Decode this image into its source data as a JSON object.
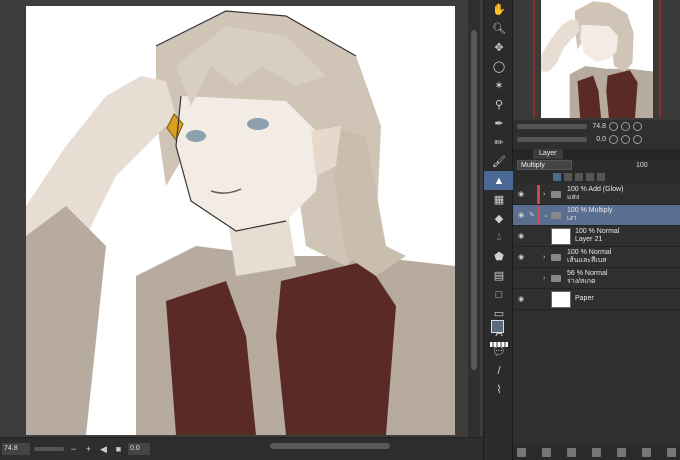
{
  "status_bar": {
    "zoom": "74.8",
    "rotation": "0.0"
  },
  "navigator": {
    "zoom_value": "74.8",
    "rotation_value": "0.0"
  },
  "layer_panel": {
    "tab_label": "Layer",
    "blend_mode": "Multiply",
    "opacity": "100",
    "layers": [
      {
        "line1": "100 % Add (Glow)",
        "line2": "แสง",
        "type": "folder",
        "visible": true,
        "selected": false,
        "color": "#c94b4b"
      },
      {
        "line1": "100 % Multiply",
        "line2": "เงา",
        "type": "folder",
        "visible": true,
        "selected": true,
        "color": "#c94b4b"
      },
      {
        "line1": "100 % Normal",
        "line2": "Layer 21",
        "type": "raster",
        "visible": true,
        "selected": false,
        "color": ""
      },
      {
        "line1": "100 % Normal",
        "line2": "เส้นและสีเบส",
        "type": "folder",
        "visible": true,
        "selected": false,
        "color": ""
      },
      {
        "line1": "56 % Normal",
        "line2": "ร่าง/สเกต",
        "type": "folder",
        "visible": false,
        "selected": false,
        "color": ""
      },
      {
        "line1": "",
        "line2": "Paper",
        "type": "paper",
        "visible": true,
        "selected": false,
        "color": ""
      }
    ]
  },
  "toolbar": {
    "tools": [
      "hand-icon",
      "zoom-icon",
      "move-icon",
      "lasso-icon",
      "magic-wand-icon",
      "eyedropper-icon",
      "pen-icon",
      "pencil-icon",
      "brush-icon",
      "airbrush-icon",
      "decoration-icon",
      "eraser-icon",
      "blend-icon",
      "fill-icon",
      "gradient-icon",
      "figure-icon",
      "ruler-icon",
      "text-icon",
      "balloon-icon",
      "line-icon",
      "correct-line-icon"
    ],
    "active_tool": "airbrush-icon",
    "foreground_color": "#5b6b7b",
    "background_color": "#000000"
  }
}
